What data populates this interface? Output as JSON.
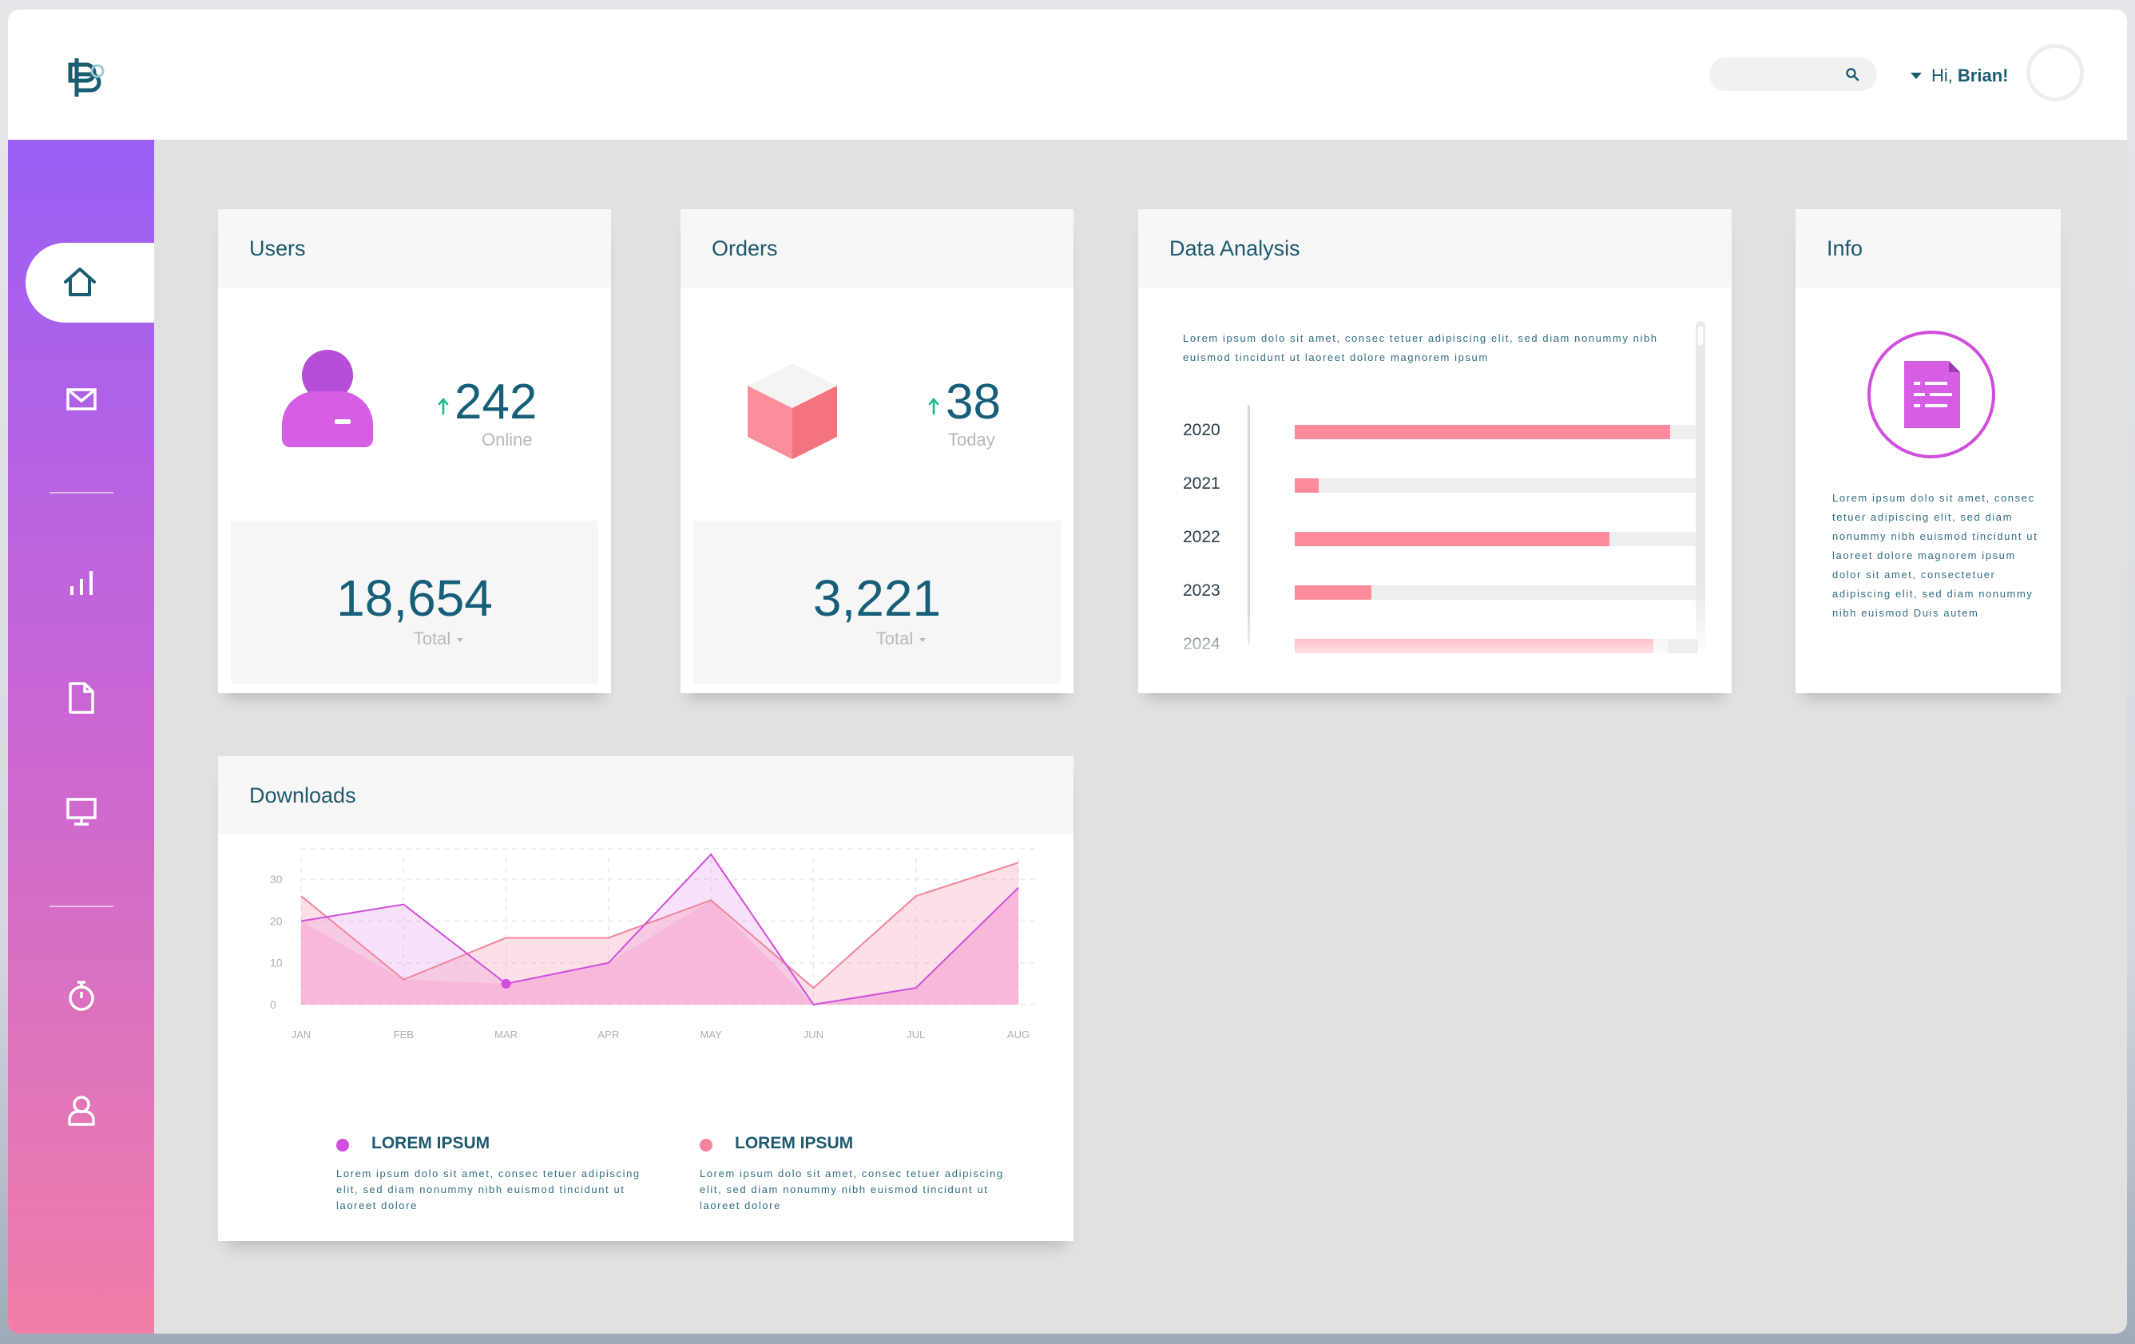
{
  "header": {
    "search_placeholder": "",
    "greeting": "Hi,",
    "user_name": "Brian!"
  },
  "sidebar": {
    "items": [
      {
        "icon": "home-icon",
        "active": true
      },
      {
        "icon": "mail-icon"
      },
      {
        "icon": "bar-chart-icon"
      },
      {
        "icon": "document-icon"
      },
      {
        "icon": "monitor-icon"
      },
      {
        "icon": "stopwatch-icon"
      },
      {
        "icon": "user-icon"
      }
    ]
  },
  "users": {
    "title": "Users",
    "online_value": "242",
    "online_label": "Online",
    "total_value": "18,654",
    "total_label": "Total"
  },
  "orders": {
    "title": "Orders",
    "today_value": "38",
    "today_label": "Today",
    "total_value": "3,221",
    "total_label": "Total"
  },
  "data_analysis": {
    "title": "Data Analysis",
    "description": "Lorem ipsum dolo sit amet, consec tetuer adipiscing elit, sed diam nonummy nibh euismod tincidunt ut laoreet dolore magnorem ipsum",
    "bars": [
      {
        "year": "2020",
        "value": 0.93
      },
      {
        "year": "2021",
        "value": 0.06
      },
      {
        "year": "2022",
        "value": 0.78
      },
      {
        "year": "2023",
        "value": 0.19
      },
      {
        "year": "2024",
        "value": 0.89
      }
    ]
  },
  "info": {
    "title": "Info",
    "text": "Lorem ipsum dolo sit amet, consec tetuer adipiscing elit, sed diam nonummy nibh euismod tincidunt ut laoreet dolore magnorem ipsum dolor sit amet, consectetuer adipiscing elit, sed diam nonummy nibh euismod Duis autem"
  },
  "downloads": {
    "title": "Downloads",
    "legend": [
      {
        "label": "LOREM IPSUM",
        "color": "#d04fdc",
        "text": "Lorem ipsum dolo sit amet, consec tetuer adipiscing elit, sed diam nonummy nibh euismod tincidunt ut laoreet dolore"
      },
      {
        "label": "LOREM IPSUM",
        "color": "#f2849b",
        "text": "Lorem ipsum dolo sit amet, consec tetuer adipiscing elit, sed diam nonummy nibh euismod tincidunt ut laoreet dolore"
      }
    ]
  },
  "colors": {
    "accent": "#175e78",
    "sidebar_top": "#9a5ff5",
    "sidebar_bottom": "#f07ea8",
    "bar": "#fd8b9b",
    "purple": "#d04fdc"
  },
  "chart_data": {
    "type": "area",
    "categories": [
      "JAN",
      "FEB",
      "MAR",
      "APR",
      "MAY",
      "JUN",
      "JUL",
      "AUG"
    ],
    "ylim": [
      0,
      35
    ],
    "yticks": [
      "0",
      "10",
      "20",
      "30"
    ],
    "grid": true,
    "series": [
      {
        "name": "LOREM IPSUM",
        "color": "#d04fdc",
        "values": [
          20,
          24,
          5,
          10,
          36,
          0,
          4,
          28
        ]
      },
      {
        "name": "LOREM IPSUM",
        "color": "#f2849b",
        "values": [
          26,
          6,
          16,
          16,
          25,
          4,
          26,
          34
        ]
      }
    ]
  }
}
